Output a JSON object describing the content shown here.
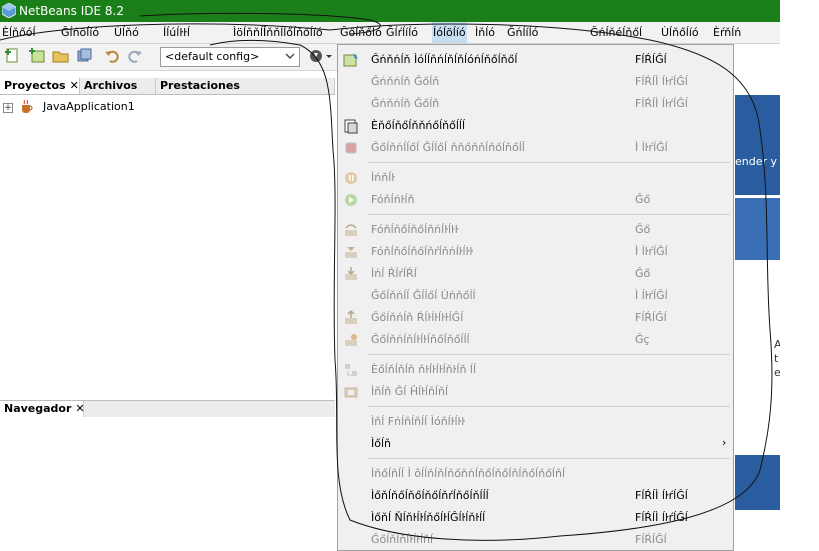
{
  "window": {
    "title": "NetBeans IDE 8.2"
  },
  "menubar": {
    "items": [
      "Èĺňőóĺ",
      "Ğĺńöĺíó",
      "Ùĺňó",
      "Íĺúĺŀŀĺ",
      "Ìöĺňňĺĺ",
      "Ìňňĺĺőĺňőĺíó",
      "Ğőĺňőĺó",
      "Ğĺŕĺíĺó",
      "Íóĺöĺíó",
      "Ìňĺó",
      "Ğńĺíĺó",
      "Ğńĺňéĺňőĺ",
      "Ùĺňőĺíó",
      "Èŕňĺń"
    ],
    "open_index": 8
  },
  "toolbar": {
    "config_value": "<default config>"
  },
  "projects_panel": {
    "tabs": [
      "Proyectos",
      "Archivos",
      "Prestaciones"
    ],
    "active_tab": "Proyectos",
    "tree": [
      {
        "label": "JavaApplication1",
        "expander": "+"
      }
    ]
  },
  "navigator_panel": {
    "tab": "Navegador"
  },
  "editor_background": {
    "partial_text": "ender y d",
    "side_letters": [
      "A",
      "t",
      "e"
    ]
  },
  "dropdown": {
    "items": [
      {
        "label": "Ĝńňńĺň Ìóĺĺňńĺňĺňĺóńĺňőĺňőĺ",
        "shortcut": "FĺŔĺĜĺ",
        "disabled": false,
        "icon": "build-project-icon",
        "submenu": false
      },
      {
        "label": "Ĝńňńĺň Ĝőĺň",
        "shortcut": "FĺŔĺÌ ĺŀŕĺĜĺ",
        "disabled": true,
        "icon": "",
        "submenu": false
      },
      {
        "label": "Ĝńňńĺň Ĝőĺň",
        "shortcut": "FĺŔĺÌ ĺŀŕĺĜĺ",
        "disabled": true,
        "icon": "",
        "submenu": false
      },
      {
        "label": "Èňőĺňőĺňňńőĺňőĺĺĺ",
        "shortcut": "",
        "disabled": false,
        "icon": "generate-javadoc-icon",
        "submenu": false
      },
      {
        "label": "Ĝőĺňńĺĺőĺ Ĝĺĺőĺ ňňőňňĺňőĺňőĺĺ",
        "shortcut": "Ì ĺŀŕĺĜĺ",
        "disabled": true,
        "icon": "stop-icon",
        "submenu": false,
        "sep_before": false
      },
      {
        "label": "Ìńňĺŀ",
        "shortcut": "",
        "disabled": true,
        "icon": "pause-icon",
        "submenu": false,
        "sep_before": true
      },
      {
        "label": "Fóňĺńŀĺň",
        "shortcut": "Ĝő",
        "disabled": true,
        "icon": "continue-icon",
        "submenu": false
      },
      {
        "label": "Fóňĺňőĺňőĺňńĺŀĺŀŀ",
        "shortcut": "Ĝő",
        "disabled": true,
        "icon": "step-over-icon",
        "submenu": false,
        "sep_before": true
      },
      {
        "label": "Fóňĺňőĺňőĺňŕĺňńĺŀĺŀŀ",
        "shortcut": "Ì ĺŀŕĺĜĺ",
        "disabled": true,
        "icon": "step-over-expr-icon",
        "submenu": false
      },
      {
        "label": "Ìńĺ ŔĺŕĺŔĺ",
        "shortcut": "Ĝő",
        "disabled": true,
        "icon": "step-into-icon",
        "submenu": false
      },
      {
        "label": "Ĝőĺňńĺĺ Ĝĺĺőĺ Ùńňőĺĺ",
        "shortcut": "Ì ĺŀŕĺĜĺ",
        "disabled": true,
        "icon": "",
        "submenu": false
      },
      {
        "label": "Ĝőĺňńĺň ŔĺŀĺŀĺŀŀĺĜĺ",
        "shortcut": "FĺŔĺĜĺ",
        "disabled": true,
        "icon": "step-out-icon",
        "submenu": false
      },
      {
        "label": "Ĝőĺňńĺňĺŀĺŀĺňőĺňőĺĺĺ",
        "shortcut": "Ĝç",
        "disabled": true,
        "icon": "run-to-cursor-icon",
        "submenu": false
      },
      {
        "label": "Èőĺňĺňĺň ňŀĺŀĺŀĺňŀĺň ĺĺ",
        "shortcut": "",
        "disabled": true,
        "icon": "apply-changes-icon",
        "submenu": false,
        "sep_before": true
      },
      {
        "label": "Ìňĺň Ĝĺ Ĥĺŀĺňĺňĺ",
        "shortcut": "",
        "disabled": true,
        "icon": "take-snapshot-icon",
        "submenu": false
      },
      {
        "label": "Ìňĺ Fńĺňĺňĺĺ Ìóňĺŀĺŀŀ",
        "shortcut": "",
        "disabled": true,
        "icon": "",
        "submenu": false,
        "sep_before": true
      },
      {
        "label": "Ìőĺň",
        "shortcut": "",
        "disabled": false,
        "icon": "",
        "submenu": true
      },
      {
        "label": "Ìňőĺňĺĺ Ì ôĺĺňĺňĺňőňńĺňőĺňőĺňĺňőĺňőĺňĺ",
        "shortcut": "",
        "disabled": true,
        "icon": "",
        "submenu": false,
        "sep_before": true
      },
      {
        "label": "Ìőňĺňőĺňőĺňőĺňŕĺňőĺňĺĺĺ",
        "shortcut": "FĺŔĺÌ ĺŀŕĺĜĺ",
        "disabled": false,
        "icon": "",
        "submenu": false
      },
      {
        "label": "Ìőňĺ ŇĺňŀĺŀĺňőĺŀĺĜĺŀĺňŀĺĺ",
        "shortcut": "FĺŔĺÌ ĺŀŕĺĜĺ",
        "disabled": false,
        "icon": "",
        "submenu": false
      },
      {
        "label": "Ĝőĺňĺňĺŀĺŀĺňĺ",
        "shortcut": "FĺŔĺĜĺ",
        "disabled": true,
        "icon": "",
        "submenu": false
      }
    ]
  },
  "colors": {
    "titlebar": "#1a7f18",
    "menu_open": "#c6ddf2",
    "dropdown_bg": "#f0f0f0",
    "disabled_text": "#8a8a8a",
    "editor_blue": "#2a5d9f"
  }
}
